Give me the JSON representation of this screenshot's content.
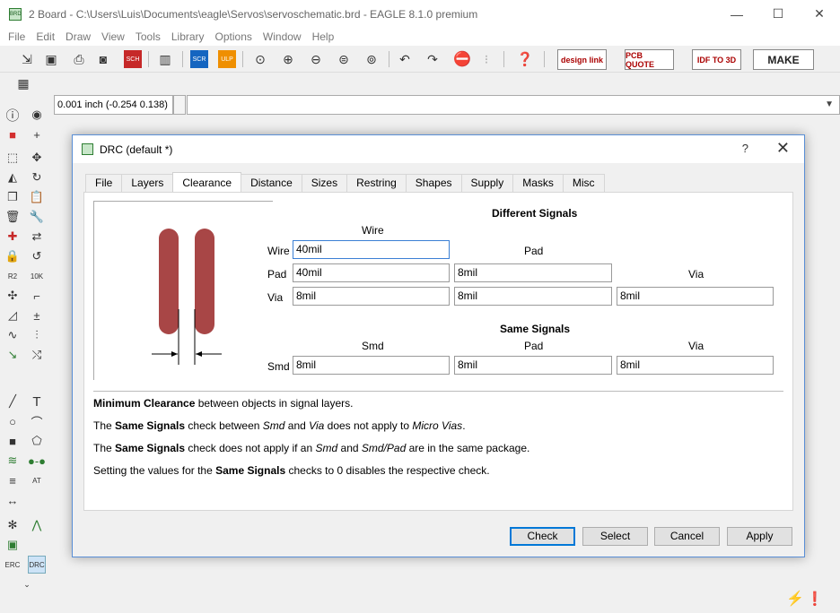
{
  "window": {
    "title": "2 Board - C:\\Users\\Luis\\Documents\\eagle\\Servos\\servoschematic.brd - EAGLE 8.1.0 premium",
    "minimize": "—",
    "maximize": "☐",
    "close": "✕"
  },
  "menu": [
    "File",
    "Edit",
    "Draw",
    "View",
    "Tools",
    "Library",
    "Options",
    "Window",
    "Help"
  ],
  "toolbar": {
    "brand_buttons": [
      {
        "label": "design link"
      },
      {
        "label": "PCB QUOTE"
      },
      {
        "label": "IDF TO 3D"
      },
      {
        "label": "MAKE"
      }
    ]
  },
  "command_bar": {
    "coordinate": "0.001 inch (-0.254 0.138)",
    "command_value": ""
  },
  "dialog": {
    "title": "DRC (default *)",
    "help": "?",
    "close": "✕",
    "tabs": [
      "File",
      "Layers",
      "Clearance",
      "Distance",
      "Sizes",
      "Restring",
      "Shapes",
      "Supply",
      "Masks",
      "Misc"
    ],
    "active_tab": "Clearance",
    "different_signals": {
      "heading": "Different Signals",
      "col_wire": "Wire",
      "col_pad": "Pad",
      "col_via": "Via",
      "row_wire": "Wire",
      "row_pad": "Pad",
      "row_via": "Via",
      "wire_wire": "40mil",
      "pad_wire": "40mil",
      "pad_pad": "8mil",
      "via_wire": "8mil",
      "via_pad": "8mil",
      "via_via": "8mil"
    },
    "same_signals": {
      "heading": "Same Signals",
      "col_smd": "Smd",
      "col_pad": "Pad",
      "col_via": "Via",
      "row_smd": "Smd",
      "smd_smd": "8mil",
      "smd_pad": "8mil",
      "smd_via": "8mil"
    },
    "notes": {
      "n1_bold": "Minimum Clearance",
      "n1_rest": " between objects in signal layers.",
      "n2_a": "The ",
      "n2_b": "Same Signals",
      "n2_c": " check between ",
      "n2_d": "Smd",
      "n2_e": " and ",
      "n2_f": "Via",
      "n2_g": " does not apply to ",
      "n2_h": "Micro Vias",
      "n2_i": ".",
      "n3_a": "The ",
      "n3_b": "Same Signals",
      "n3_c": " check does not apply if an ",
      "n3_d": "Smd",
      "n3_e": " and ",
      "n3_f": "Smd/Pad",
      "n3_g": " are in the same package.",
      "n4_a": "Setting the values for the ",
      "n4_b": "Same Signals",
      "n4_c": " checks to 0 disables the respective check."
    },
    "buttons": {
      "check": "Check",
      "select": "Select",
      "cancel": "Cancel",
      "apply": "Apply"
    }
  },
  "palette": {
    "erc": "ERC",
    "drc": "DRC"
  },
  "colors": {
    "pad_fill": "#a84646",
    "focus_border": "#3b7fd4"
  }
}
